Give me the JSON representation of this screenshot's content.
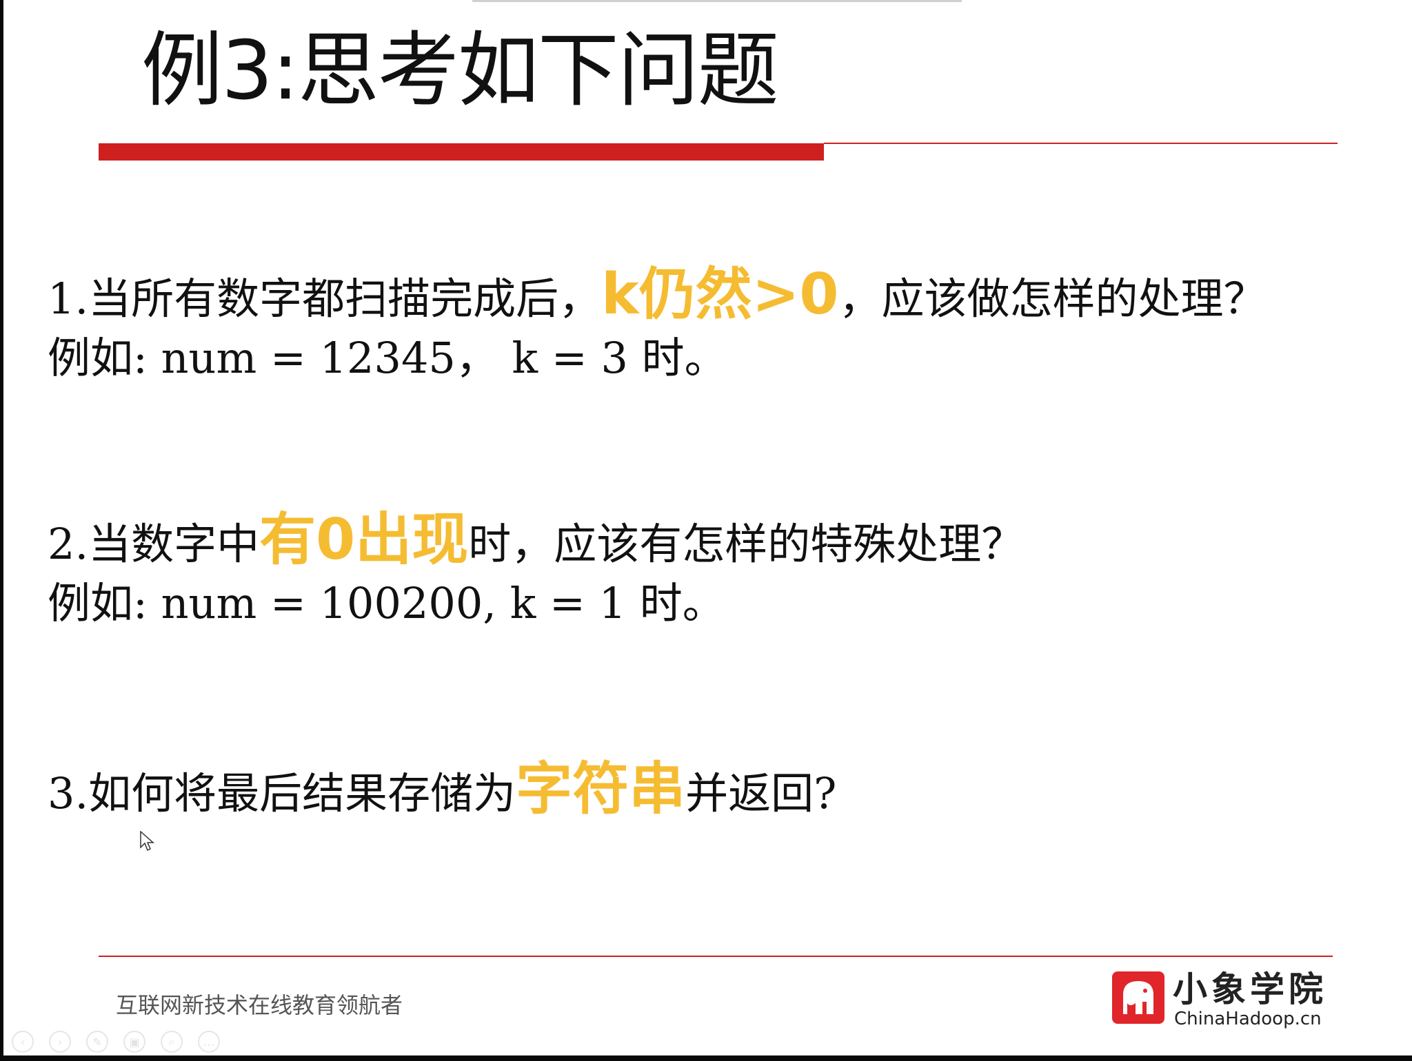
{
  "slide": {
    "title": "例3:思考如下问题",
    "questions": [
      {
        "line1_pre": "1.当所有数字都扫描完成后，",
        "line1_hl": "k仍然>0",
        "line1_post": "，应该做怎样的处理？",
        "line2": "例如: num = 12345，  k = 3 时。"
      },
      {
        "line1_pre": "2.当数字中",
        "line1_hl": "有0出现",
        "line1_post": "时，应该有怎样的特殊处理？",
        "line2": "例如: num = 100200,  k = 1 时。"
      },
      {
        "line1_pre": "3.如何将最后结果存储为",
        "line1_hl": "字符串",
        "line1_post": "并返回?"
      }
    ],
    "footer": {
      "slogan": "互联网新技术在线教育领航者",
      "logo_name": "小象学院",
      "logo_domain": "ChinaHadoop.cn"
    }
  },
  "toolbar": {
    "buttons": [
      {
        "icon": "previous-icon",
        "glyph": "‹"
      },
      {
        "icon": "next-icon",
        "glyph": "›"
      },
      {
        "icon": "pen-icon",
        "glyph": "✎"
      },
      {
        "icon": "slides-icon",
        "glyph": "▣"
      },
      {
        "icon": "zoom-icon",
        "glyph": "⌕"
      },
      {
        "icon": "more-icon",
        "glyph": "…"
      }
    ]
  },
  "colors": {
    "accent_red": "#cf2020",
    "highlight_yellow": "#f5bc32",
    "logo_red": "#e0262a"
  }
}
